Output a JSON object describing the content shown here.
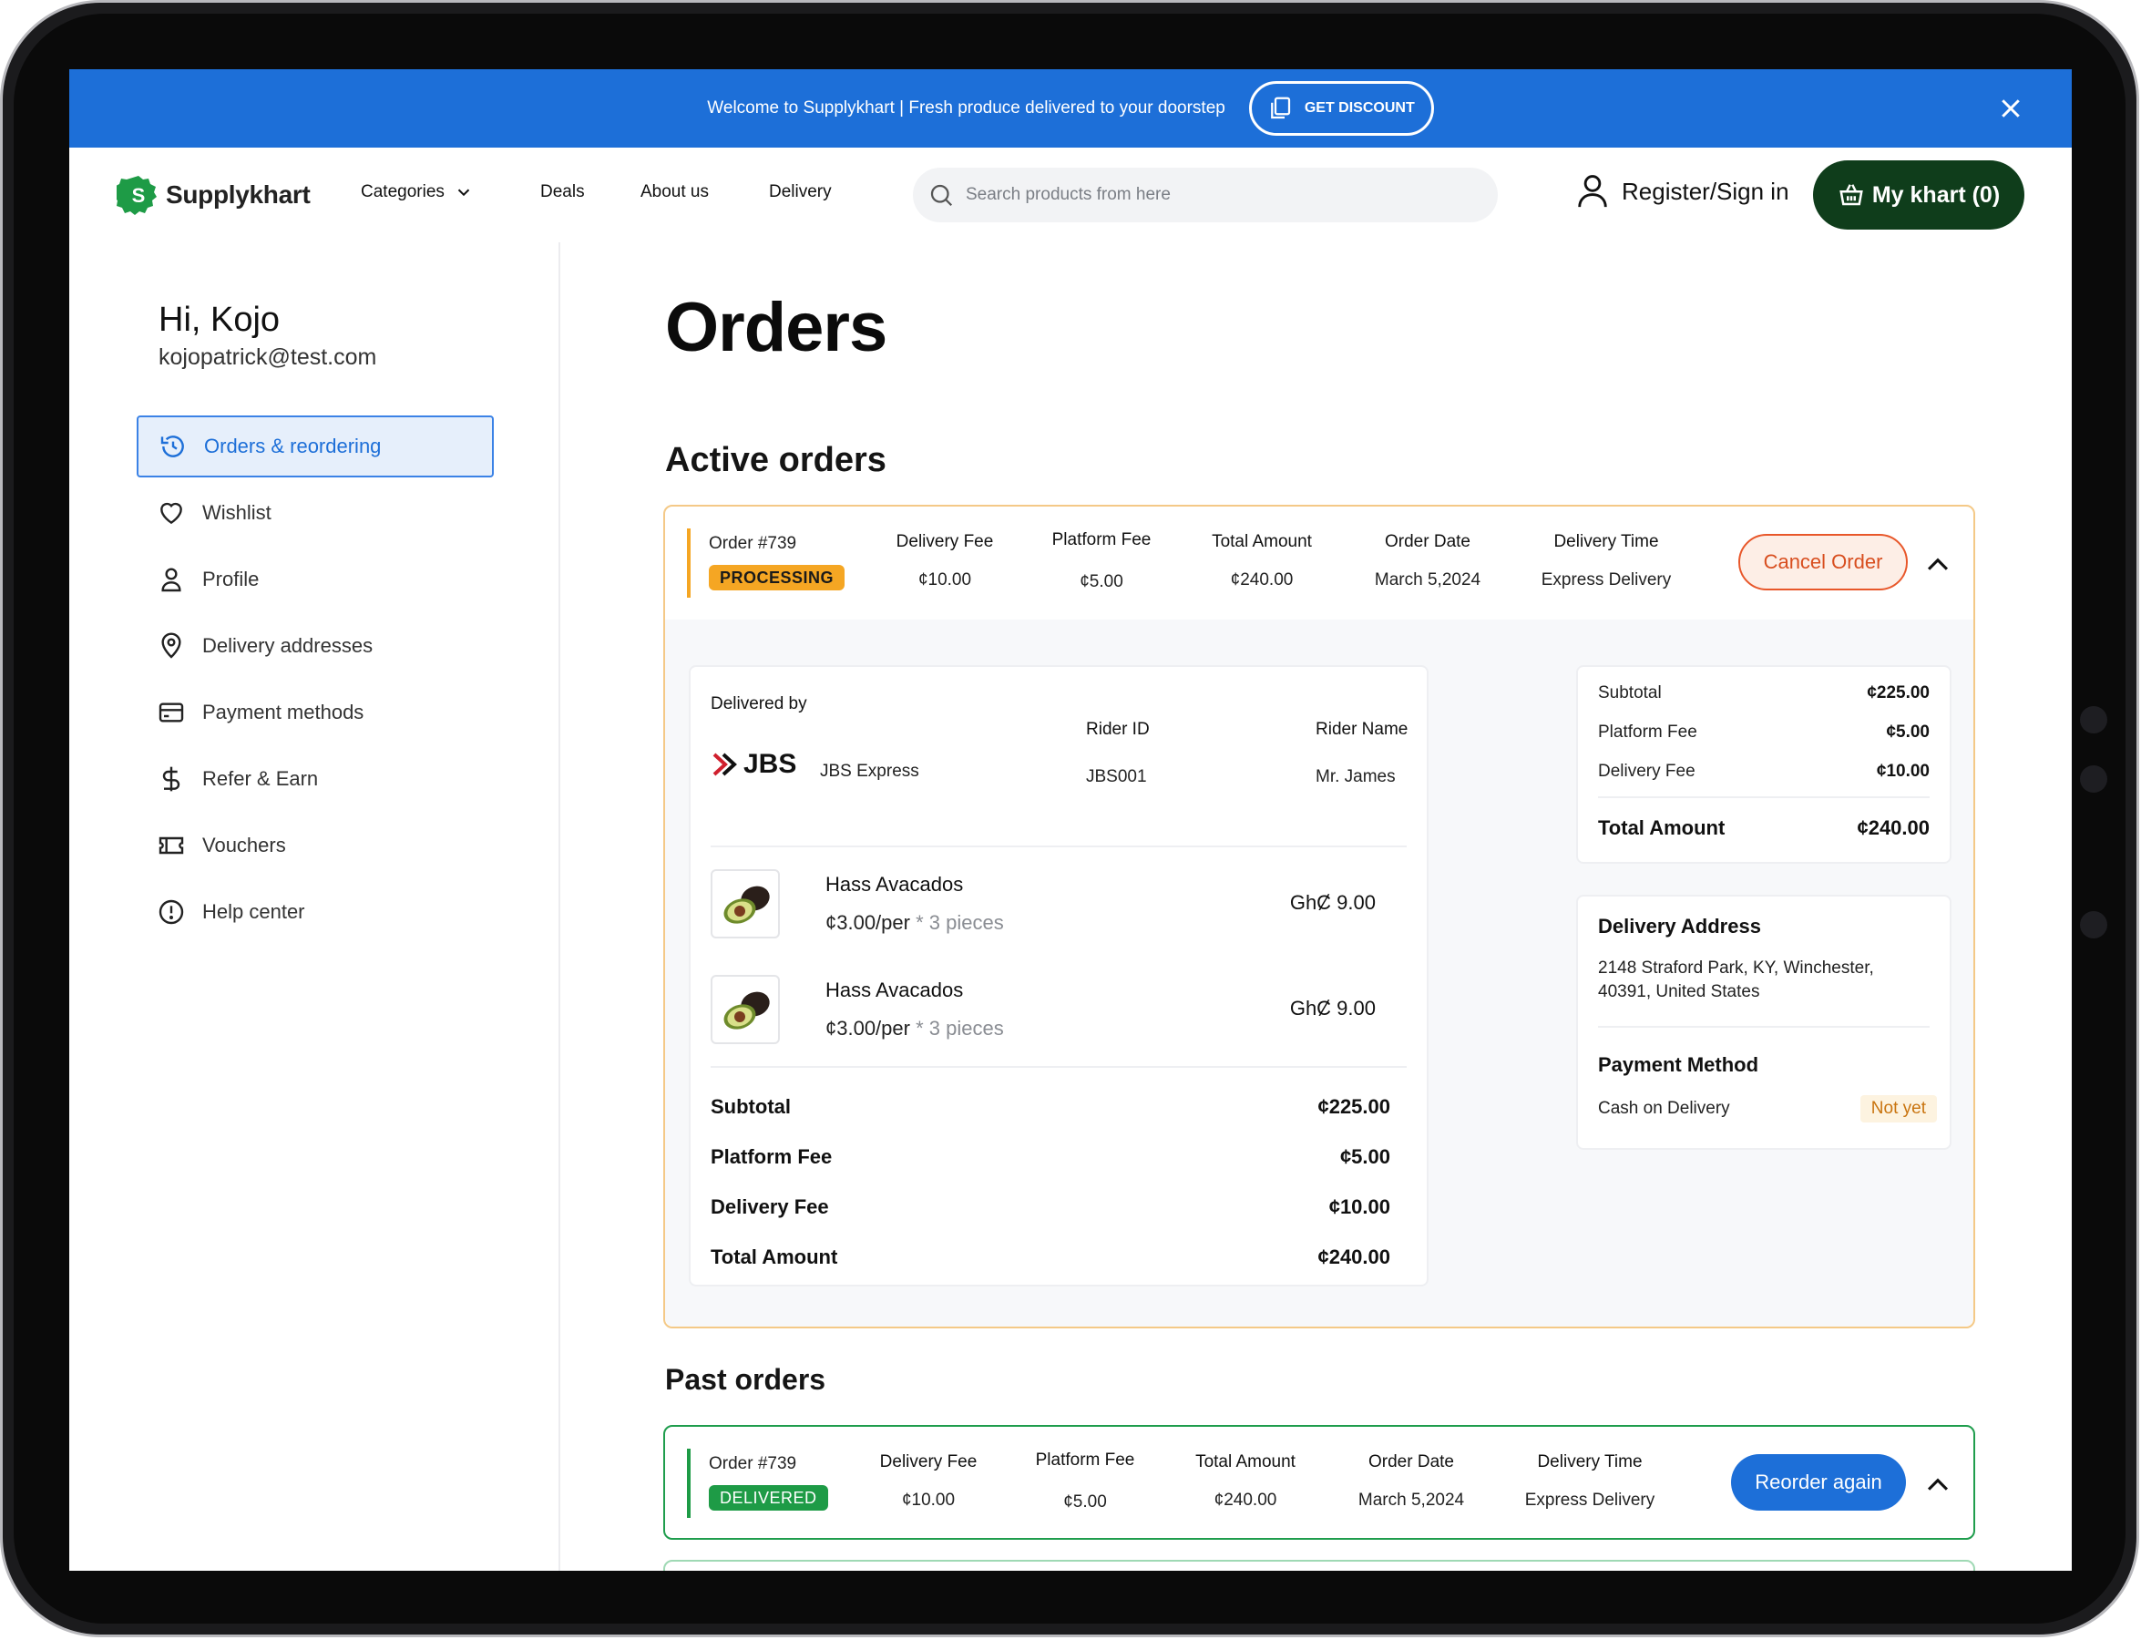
{
  "promo": {
    "text": "Welcome to Supplykhart | Fresh produce delivered to your doorstep",
    "button_label": "GET DISCOUNT"
  },
  "nav": {
    "brand": "Supplykhart",
    "categories_label": "Categories",
    "deals_label": "Deals",
    "about_label": "About us",
    "delivery_label": "Delivery",
    "search_placeholder": "Search products from here",
    "signin_label": "Register/Sign in",
    "cart_label": "My khart (0)"
  },
  "sidebar": {
    "greeting": "Hi, Kojo",
    "email": "kojopatrick@test.com",
    "items": [
      {
        "label": "Orders & reordering",
        "icon": "history-icon"
      },
      {
        "label": "Wishlist",
        "icon": "heart-icon"
      },
      {
        "label": "Profile",
        "icon": "user-icon"
      },
      {
        "label": "Delivery addresses",
        "icon": "location-pin-icon"
      },
      {
        "label": "Payment methods",
        "icon": "credit-card-icon"
      },
      {
        "label": "Refer & Earn",
        "icon": "dollar-icon"
      },
      {
        "label": "Vouchers",
        "icon": "ticket-icon"
      },
      {
        "label": "Help center",
        "icon": "info-icon"
      }
    ]
  },
  "main": {
    "title": "Orders",
    "active_title": "Active orders",
    "past_title": "Past orders"
  },
  "active_order": {
    "id": "Order #739",
    "status": "PROCESSING",
    "cols": [
      {
        "label": "Delivery Fee",
        "value": "¢10.00"
      },
      {
        "label": "Platform Fee",
        "value": "¢5.00"
      },
      {
        "label": "Total Amount",
        "value": "¢240.00"
      },
      {
        "label": "Order Date",
        "value": "March 5,2024"
      },
      {
        "label": "Delivery Time",
        "value": "Express Delivery"
      }
    ],
    "action_label": "Cancel Order",
    "delivered_by_label": "Delivered by",
    "courier_logo_text": "JBS",
    "courier_name": "JBS Express",
    "rider_id_label": "Rider ID",
    "rider_id": "JBS001",
    "rider_name_label": "Rider Name",
    "rider_name": "Mr. James",
    "items": [
      {
        "name": "Hass Avacados",
        "unit_price": "¢3.00/per",
        "sep": "*",
        "qty": "3 pieces",
        "price": "GhȻ 9.00"
      },
      {
        "name": "Hass Avacados",
        "unit_price": "¢3.00/per",
        "sep": "*",
        "qty": "3 pieces",
        "price": "GhȻ 9.00"
      }
    ],
    "summary": [
      {
        "label": "Subtotal",
        "value": "¢225.00"
      },
      {
        "label": "Platform Fee",
        "value": "¢5.00"
      },
      {
        "label": "Delivery Fee",
        "value": "¢10.00"
      },
      {
        "label": "Total Amount",
        "value": "¢240.00"
      }
    ],
    "right_summary": [
      {
        "label": "Subtotal",
        "value": "¢225.00"
      },
      {
        "label": "Platform Fee",
        "value": "¢5.00"
      },
      {
        "label": "Delivery Fee",
        "value": "¢10.00"
      }
    ],
    "right_total": {
      "label": "Total Amount",
      "value": "¢240.00"
    },
    "address_title": "Delivery Address",
    "address": "2148 Straford Park, KY, Winchester, 40391, United States",
    "payment_title": "Payment Method",
    "payment_method": "Cash on Delivery",
    "payment_status": "Not yet"
  },
  "past_order": {
    "id": "Order #739",
    "status": "DELIVERED",
    "cols": [
      {
        "label": "Delivery Fee",
        "value": "¢10.00"
      },
      {
        "label": "Platform Fee",
        "value": "¢5.00"
      },
      {
        "label": "Total Amount",
        "value": "¢240.00"
      },
      {
        "label": "Order Date",
        "value": "March 5,2024"
      },
      {
        "label": "Delivery Time",
        "value": "Express Delivery"
      }
    ],
    "action_label": "Reorder again"
  },
  "colors": {
    "brand_blue": "#1d6fd8",
    "cart_green": "#0f3d1b",
    "processing": "#f5a623",
    "delivered": "#1e9b46",
    "cancel": "#e8572a"
  }
}
